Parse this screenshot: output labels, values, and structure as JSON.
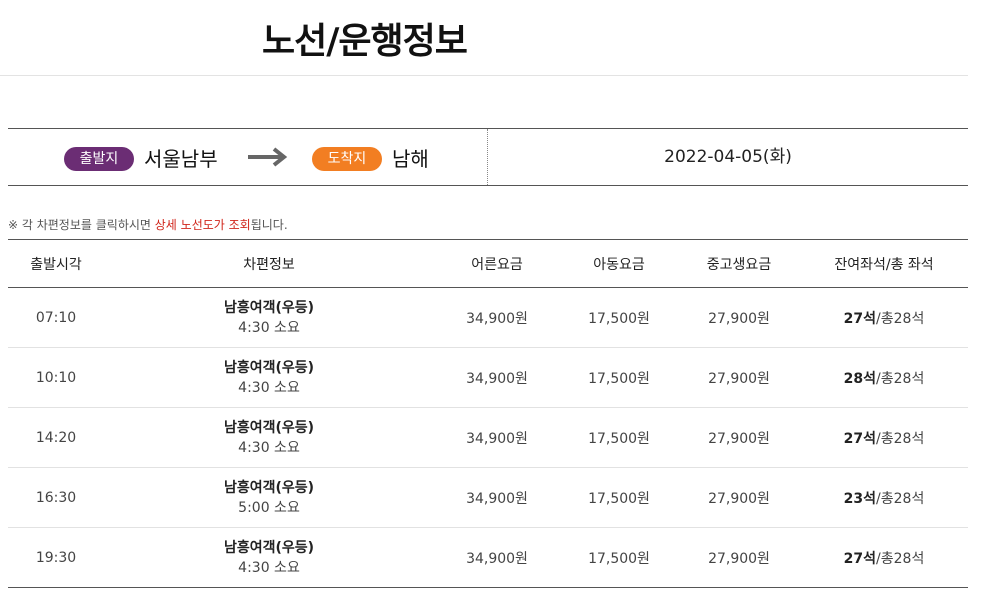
{
  "page": {
    "title": "노선/운행정보"
  },
  "route": {
    "departure_badge": "출발지",
    "departure": "서울남부",
    "arrival_badge": "도착지",
    "arrival": "남해",
    "date": "2022-04-05(화)",
    "colors": {
      "departure_badge": "#6b2d74",
      "arrival_badge": "#f27e22"
    }
  },
  "notice": {
    "prefix": "※ 각 차편정보를 클릭하시면 ",
    "highlight": "상세 노선도가 조회",
    "suffix": "됩니다.",
    "highlight_color": "#d1261c"
  },
  "table": {
    "headers": [
      "출발시각",
      "차편정보",
      "어른요금",
      "아동요금",
      "중고생요금",
      "잔여좌석/총 좌석"
    ],
    "rows": [
      {
        "time": "07:10",
        "bus": "남흥여객(우등)",
        "duration": "4:30 소요",
        "adult": "34,900원",
        "child": "17,500원",
        "student": "27,900원",
        "seats_left": "27석",
        "seats_total": "/총28석"
      },
      {
        "time": "10:10",
        "bus": "남흥여객(우등)",
        "duration": "4:30 소요",
        "adult": "34,900원",
        "child": "17,500원",
        "student": "27,900원",
        "seats_left": "28석",
        "seats_total": "/총28석"
      },
      {
        "time": "14:20",
        "bus": "남흥여객(우등)",
        "duration": "4:30 소요",
        "adult": "34,900원",
        "child": "17,500원",
        "student": "27,900원",
        "seats_left": "27석",
        "seats_total": "/총28석"
      },
      {
        "time": "16:30",
        "bus": "남흥여객(우등)",
        "duration": "5:00 소요",
        "adult": "34,900원",
        "child": "17,500원",
        "student": "27,900원",
        "seats_left": "23석",
        "seats_total": "/총28석"
      },
      {
        "time": "19:30",
        "bus": "남흥여객(우등)",
        "duration": "4:30 소요",
        "adult": "34,900원",
        "child": "17,500원",
        "student": "27,900원",
        "seats_left": "27석",
        "seats_total": "/총28석"
      }
    ]
  }
}
